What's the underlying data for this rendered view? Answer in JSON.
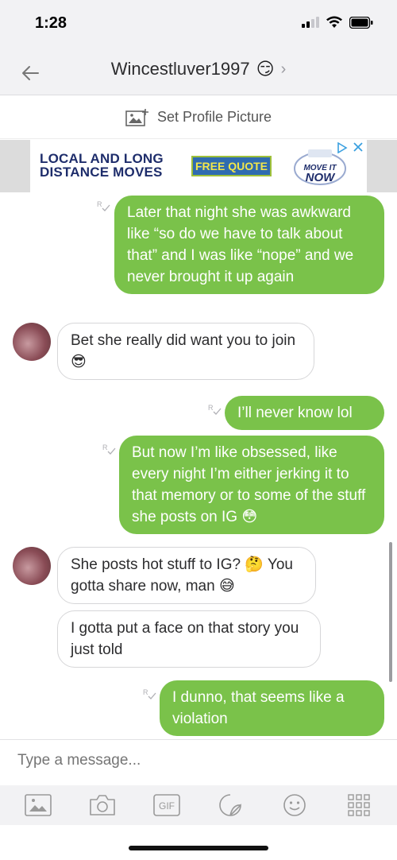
{
  "status_bar": {
    "time": "1:28"
  },
  "header": {
    "title": "Wincestluver1997",
    "title_emoji": "😏",
    "chevron": "›",
    "back_icon": "arrow-left-icon"
  },
  "profile": {
    "set_label": "Set Profile Picture"
  },
  "ad": {
    "line1": "LOCAL AND LONG",
    "line2": "DISTANCE MOVES",
    "cta": "FREE QUOTE",
    "logo_top": "MOVE IT",
    "logo_bottom": "NOW",
    "colors": {
      "cta_bg": "#2f6bb0",
      "cta_text": "#f2e64a",
      "text": "#1e2d6b"
    }
  },
  "messages": [
    {
      "dir": "out",
      "text": "Later that night she was awkward like “so do we have to talk about that” and I was like “nope” and we never brought it up again"
    },
    {
      "dir": "in",
      "text": "Bet she really did want you to join 😎"
    },
    {
      "dir": "out",
      "text": "I’ll never know lol"
    },
    {
      "dir": "out",
      "text": "But now I’m like obsessed, like every night I’m either jerking it to that memory or to some of the stuff she posts on IG 😳"
    },
    {
      "dir": "in",
      "text": "She posts hot stuff to IG? 🤔 You gotta share now, man 😅"
    },
    {
      "dir": "in",
      "text": "I gotta put a face on that story you just told"
    },
    {
      "dir": "out",
      "text": "I dunno, that seems like a violation"
    }
  ],
  "composer": {
    "placeholder": "Type a message..."
  },
  "toolbar": {
    "gif_label": "GIF",
    "icons": [
      "gallery-icon",
      "camera-icon",
      "gif-icon",
      "sticker-icon",
      "emoji-icon",
      "apps-grid-icon"
    ]
  },
  "colors": {
    "outgoing": "#7ac24a",
    "incoming_border": "#d6d6d8",
    "bar_bg": "#f2f2f4"
  }
}
